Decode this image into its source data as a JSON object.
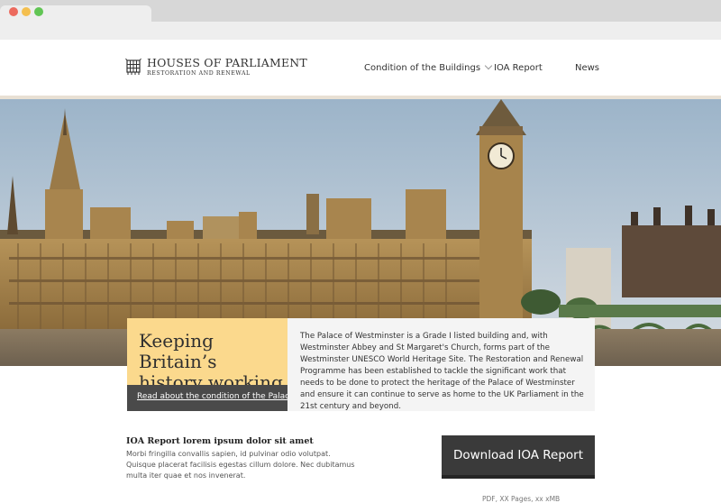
{
  "header": {
    "logo_title": "HOUSES OF PARLIAMENT",
    "logo_subtitle": "RESTORATION AND RENEWAL",
    "nav": [
      {
        "label": "Condition of the Buildings",
        "has_dropdown": true
      },
      {
        "label": "IOA Report"
      },
      {
        "label": "News"
      }
    ]
  },
  "hero": {
    "image": "palace-of-westminster-photo"
  },
  "callout": {
    "title": "Keeping Britain’s history working",
    "link": "Read about the condition of the Palace",
    "intro": "The Palace of Westminster is a Grade I listed building and, with Westminster Abbey and St Margaret's Church, forms part of the Westminster UNESCO World Heritage Site. The Restoration and Renewal Programme has been established to tackle the significant work that needs to be done to protect the heritage of the Palace of Westminster and ensure it can continue to serve as home to the UK Parliament in the 21st century and beyond."
  },
  "ioa": {
    "title": "IOA Report lorem ipsum dolor sit amet",
    "body": "Morbi fringilla convallis sapien, id pulvinar odio volutpat. Quisque placerat facilisis egestas cillum dolore. Nec dubitamus multa iter quae et nos invenerat.",
    "download_label": "Download IOA Report",
    "download_meta": "PDF, XX Pages, xx xMB"
  },
  "colors": {
    "accent_yellow": "#fbd98d",
    "dark_gray": "#4a4a4a",
    "header_rule": "#e8e0d4"
  }
}
